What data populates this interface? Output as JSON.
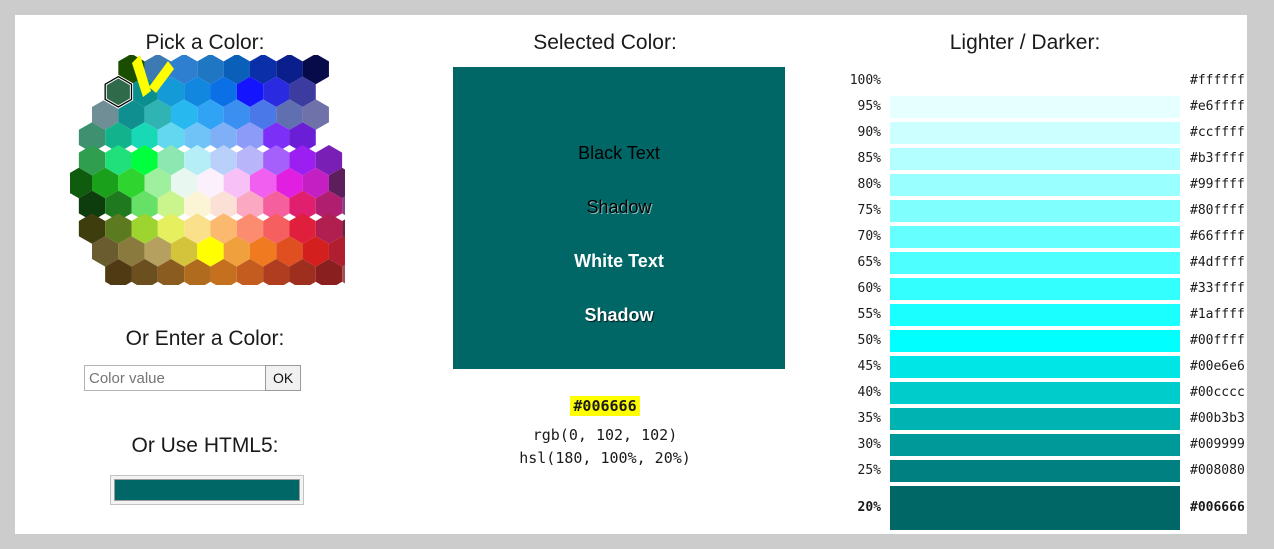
{
  "page": {
    "background_color": "#cccccc",
    "content_background": "#ffffff"
  },
  "picker": {
    "heading": "Pick a Color:",
    "annotation": "yellow-highlighter-arrow",
    "selected_cell_color": "#006666",
    "enter_heading": "Or Enter a Color:",
    "input_placeholder": "Color value",
    "input_value": "",
    "ok_label": "OK",
    "html5_heading": "Or Use HTML5:",
    "html5_value": "#006666"
  },
  "selected": {
    "heading": "Selected Color:",
    "color": "#006666",
    "samples": [
      {
        "label": "Black Text",
        "style": "black"
      },
      {
        "label": "Shadow",
        "style": "black-shadow"
      },
      {
        "label": "White Text",
        "style": "white"
      },
      {
        "label": "Shadow",
        "style": "white-shadow"
      }
    ],
    "hex": "#006666",
    "rgb": "rgb(0, 102, 102)",
    "hsl": "hsl(180, 100%, 20%)",
    "hex_highlight_color": "#ffff00"
  },
  "shades": {
    "heading": "Lighter / Darker:",
    "rows": [
      {
        "pct": "100%",
        "hex": "#ffffff",
        "current": false
      },
      {
        "pct": "95%",
        "hex": "#e6ffff",
        "current": false
      },
      {
        "pct": "90%",
        "hex": "#ccffff",
        "current": false
      },
      {
        "pct": "85%",
        "hex": "#b3ffff",
        "current": false
      },
      {
        "pct": "80%",
        "hex": "#99ffff",
        "current": false
      },
      {
        "pct": "75%",
        "hex": "#80ffff",
        "current": false
      },
      {
        "pct": "70%",
        "hex": "#66ffff",
        "current": false
      },
      {
        "pct": "65%",
        "hex": "#4dffff",
        "current": false
      },
      {
        "pct": "60%",
        "hex": "#33ffff",
        "current": false
      },
      {
        "pct": "55%",
        "hex": "#1affff",
        "current": false
      },
      {
        "pct": "50%",
        "hex": "#00ffff",
        "current": false
      },
      {
        "pct": "45%",
        "hex": "#00e6e6",
        "current": false
      },
      {
        "pct": "40%",
        "hex": "#00cccc",
        "current": false
      },
      {
        "pct": "35%",
        "hex": "#00b3b3",
        "current": false
      },
      {
        "pct": "30%",
        "hex": "#009999",
        "current": false
      },
      {
        "pct": "25%",
        "hex": "#008080",
        "current": false
      },
      {
        "pct": "20%",
        "hex": "#006666",
        "current": true
      }
    ]
  },
  "color_wheel": {
    "rows": [
      {
        "offset": 3,
        "colors": [
          "#1a4d00",
          "#3d7ab3",
          "#2f7fd1",
          "#1f77c4",
          "#0a5fb8",
          "#0b2fa8",
          "#0a1e8c",
          "#070b4a"
        ]
      },
      {
        "offset": 2,
        "colors": [
          "#2f6b4a",
          "#0a8f8f",
          "#149ad6",
          "#1287e0",
          "#0b6fe6",
          "#1414ff",
          "#2a2ae0",
          "#3c3ca0"
        ]
      },
      {
        "offset": 1,
        "colors": [
          "#6f8e96",
          "#0f8f8f",
          "#2fb3b3",
          "#27b8f0",
          "#31a3f4",
          "#3a8ff0",
          "#4a78e8",
          "#5f6fb0",
          "#6f72a8"
        ]
      },
      {
        "offset": 0,
        "colors": [
          "#3f9070",
          "#12b38c",
          "#17d9b6",
          "#63d6f0",
          "#6fc3f7",
          "#7fb0f7",
          "#8b9bf7",
          "#7b2ff7",
          "#6a1fd6"
        ]
      },
      {
        "offset": 0,
        "colors": [
          "#2f9e4f",
          "#1fe07a",
          "#00ff3c",
          "#8ce8b0",
          "#b5eef7",
          "#b9d0fb",
          "#b9b5fb",
          "#a55ffb",
          "#9b1ff0",
          "#7a1fb5"
        ]
      },
      {
        "offset": -1,
        "colors": [
          "#0f5c0f",
          "#1aa01a",
          "#2fd42f",
          "#9ef09e",
          "#e8f7ef",
          "#fbf0fb",
          "#f7c0f7",
          "#f05ff0",
          "#e01fe0",
          "#c31fc3",
          "#5c1f5c"
        ]
      },
      {
        "offset": 0,
        "colors": [
          "#0d3d0d",
          "#1f7a1f",
          "#66e066",
          "#c9f58c",
          "#fbf5d6",
          "#fbe0d6",
          "#fba8c3",
          "#f55f9e",
          "#e01f6f",
          "#b01f6f",
          "#8a3f8a"
        ]
      },
      {
        "offset": 0,
        "colors": [
          "#3d3d0d",
          "#5c7a1f",
          "#9ed42f",
          "#e6f05f",
          "#fbe08c",
          "#fbb86f",
          "#fb8c6f",
          "#f55f5f",
          "#e01f3c",
          "#b01f4f",
          "#7a1f3c"
        ]
      },
      {
        "offset": 1,
        "colors": [
          "#6b5c2f",
          "#8a7a3d",
          "#b5a05f",
          "#d4c43c",
          "#ffff00",
          "#f0a03c",
          "#f07a1f",
          "#e04f1f",
          "#d41f1f",
          "#b01f2f",
          "#8a2f3c"
        ]
      },
      {
        "offset": 2,
        "colors": [
          "#4f3a14",
          "#6b4f1f",
          "#8a5c1f",
          "#b06b1f",
          "#c4701f",
          "#c45c1f",
          "#b03d1f",
          "#9e2f1f",
          "#8a1f1f",
          "#a34f4f"
        ]
      }
    ]
  }
}
